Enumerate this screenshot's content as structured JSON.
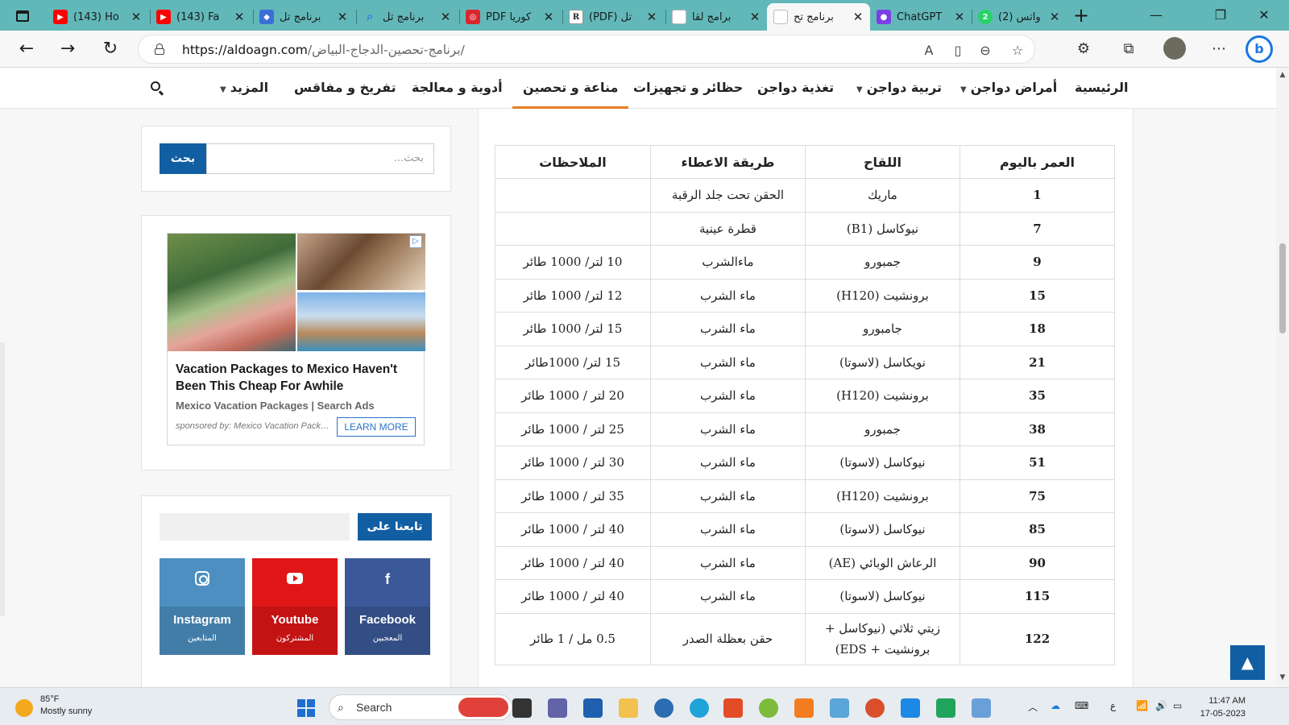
{
  "browser": {
    "tabs": [
      {
        "title": "(143) Ho",
        "favicon": "youtube-icon",
        "color": "#ff0000"
      },
      {
        "title": "(143) Fa",
        "favicon": "youtube-icon",
        "color": "#ff0000"
      },
      {
        "title": "برنامج تل",
        "favicon": "shield-icon",
        "color": "#3b6fd8"
      },
      {
        "title": "برنامج تل",
        "favicon": "search-icon",
        "color": "#2d7fd6"
      },
      {
        "title": "PDF كوريا",
        "favicon": "pdf-icon",
        "color": "#d9262e"
      },
      {
        "title": "(PDF) تل",
        "favicon": "researchgate-icon",
        "color": "#ffffff"
      },
      {
        "title": "برامج لقا",
        "favicon": "site-icon",
        "color": "#ffffff"
      },
      {
        "title": "برنامج تح",
        "favicon": "site-icon",
        "color": "#ffffff",
        "active": true
      },
      {
        "title": "ChatGPT",
        "favicon": "chatgpt-icon",
        "color": "#7b3fe4"
      },
      {
        "title": "(2) واتس",
        "favicon": "whatsapp-icon",
        "color": "#25d366"
      }
    ],
    "url_host": "https://aldoagn.com",
    "url_path": "/برنامج-تحصين-الدجاج-البياض/"
  },
  "site": {
    "nav": [
      {
        "label": "الرئيسية",
        "dropdown": false
      },
      {
        "label": "أمراض دواجن",
        "dropdown": true
      },
      {
        "label": "تربية دواجن",
        "dropdown": true
      },
      {
        "label": "تغذية دواجن",
        "dropdown": false
      },
      {
        "label": "حظائر و تجهيزات",
        "dropdown": false
      },
      {
        "label": "مناعة و تحصين",
        "dropdown": false,
        "active": true
      },
      {
        "label": "أدوية و معالجة",
        "dropdown": false
      },
      {
        "label": "تفريخ و مفاقس",
        "dropdown": false
      },
      {
        "label": "المزيد",
        "dropdown": true
      }
    ],
    "accent_color": "#e67e22",
    "brand_color": "#125ea3"
  },
  "table": {
    "headers": [
      "العمر باليوم",
      "اللقاح",
      "طريقة الاعطاء",
      "الملاحظات"
    ],
    "rows": [
      {
        "day": "1",
        "vaccine": "ماريك",
        "method": "الحقن تحت جلد الرقبة",
        "notes": ""
      },
      {
        "day": "7",
        "vaccine": "نيوكاسل (B1)",
        "method": "قطرة عينية",
        "notes": ""
      },
      {
        "day": "9",
        "vaccine": "جمبورو",
        "method": "ماءالشرب",
        "notes": "10 لتر/ 1000 طائر"
      },
      {
        "day": "15",
        "vaccine": "برونشيت (H120)",
        "method": "ماء الشرب",
        "notes": "12 لتر/ 1000 طائر"
      },
      {
        "day": "18",
        "vaccine": "جامبورو",
        "method": "ماء الشرب",
        "notes": "15 لتر/ 1000 طائر"
      },
      {
        "day": "21",
        "vaccine": "نويكاسل (لاسوتا)",
        "method": "ماء الشرب",
        "notes": "15 لتر/ 1000طائر"
      },
      {
        "day": "35",
        "vaccine": "برونشيت (H120)",
        "method": "ماء الشرب",
        "notes": "20 لتر / 1000 طائر"
      },
      {
        "day": "38",
        "vaccine": "جمبورو",
        "method": "ماء الشرب",
        "notes": "25 لتر / 1000 طائر"
      },
      {
        "day": "51",
        "vaccine": "نيوكاسل (لاسوتا)",
        "method": "ماء الشرب",
        "notes": "30 لتر / 1000 طائر"
      },
      {
        "day": "75",
        "vaccine": "برونشيت (H120)",
        "method": "ماء الشرب",
        "notes": "35 لتر / 1000 طائر"
      },
      {
        "day": "85",
        "vaccine": "نيوكاسل (لاسوتا)",
        "method": "ماء الشرب",
        "notes": "40 لتر / 1000 طائر"
      },
      {
        "day": "90",
        "vaccine": "الرعاش الوبائي (AE)",
        "method": "ماء الشرب",
        "notes": "40 لتر / 1000 طائر"
      },
      {
        "day": "115",
        "vaccine": "نيوكاسل (لاسوتا)",
        "method": "ماء الشرب",
        "notes": "40 لتر / 1000 طائر"
      },
      {
        "day": "122",
        "vaccine": "زيتي ثلاثي (نيوكاسل + برونشيت + EDS)",
        "method": "حقن بعظلة الصدر",
        "notes": "0.5 مل / 1 طائر"
      }
    ]
  },
  "sidebar": {
    "search": {
      "placeholder": "بحث...",
      "button": "بحث"
    },
    "ad": {
      "title": "Vacation Packages to Mexico Haven't Been This Cheap For Awhile",
      "subtitle": "Mexico Vacation Packages | Search Ads",
      "sponsored": "sponsored by: Mexico Vacation Packages | Search Ads",
      "cta": "LEARN MORE"
    },
    "follow": {
      "title": "تابعنا على",
      "networks": [
        {
          "name": "Facebook",
          "caption": "المعجبين",
          "icon": "facebook-icon",
          "color": "#3b5998"
        },
        {
          "name": "Youtube",
          "caption": "المشتركون",
          "icon": "youtube-icon",
          "color": "#e01616"
        },
        {
          "name": "Instagram",
          "caption": "المتابعين",
          "icon": "instagram-icon",
          "color": "#4c8fc0"
        }
      ]
    }
  },
  "taskbar": {
    "weather_temp": "85°F",
    "weather_desc": "Mostly sunny",
    "search_label": "Search",
    "time": "11:47 AM",
    "date": "17-05-2023",
    "lang": "ع"
  }
}
